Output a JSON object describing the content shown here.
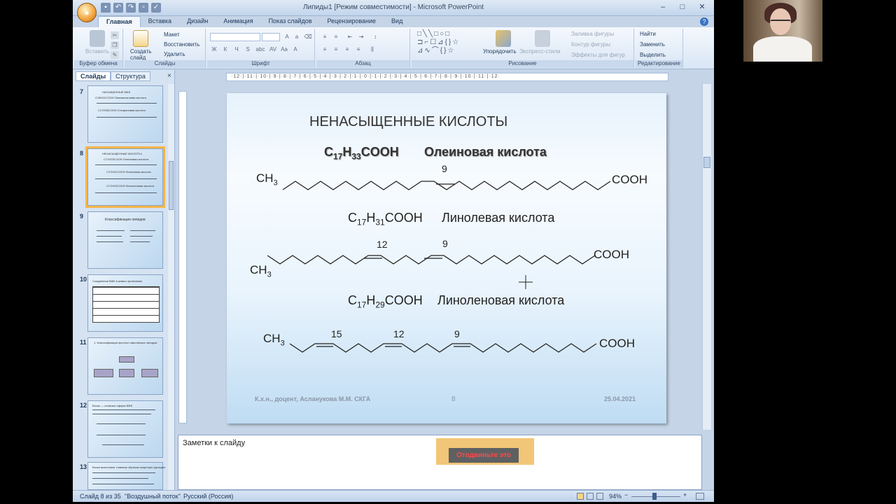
{
  "window": {
    "title": "Липиды1 [Режим совместимости] - Microsoft PowerPoint",
    "office_button_icon": "office-logo-icon",
    "qat_icons": [
      "save-icon",
      "undo-icon",
      "redo-icon",
      "print-preview-icon",
      "spelling-icon"
    ],
    "controls": [
      "–",
      "□",
      "✕"
    ]
  },
  "ribbon": {
    "tabs": [
      "Главная",
      "Вставка",
      "Дизайн",
      "Анимация",
      "Показ слайдов",
      "Рецензирование",
      "Вид"
    ],
    "active_tab": "Главная",
    "clipboard": {
      "paste": "Вставить",
      "label": "Буфер обмена"
    },
    "slides": {
      "create": "Создать слайд",
      "layout": "Макет",
      "reset": "Восстановить",
      "delete": "Удалить",
      "label": "Слайды"
    },
    "font": {
      "label": "Шрифт",
      "buttons": [
        "Ж",
        "К",
        "Ч",
        "S",
        "abc",
        "AV",
        "Aa",
        "A"
      ]
    },
    "paragraph": {
      "label": "Абзац"
    },
    "drawing": {
      "arrange": "Упорядочить",
      "quick_styles": "Экспресс-стили",
      "fill": "Заливка фигуры",
      "outline": "Контур фигуры",
      "effects": "Эффекты для фигур",
      "label": "Рисование"
    },
    "editing": {
      "find": "Найти",
      "replace": "Заменить",
      "select": "Выделить",
      "label": "Редактирование"
    }
  },
  "left_panel": {
    "tabs": [
      "Слайды",
      "Структура"
    ],
    "close": "×",
    "thumbnails": [
      {
        "num": "7",
        "lines": [
          "НАСЫЩЕННЫЕ ВЖК",
          "C15H31COOH   Пальмитиновая кислота",
          "C17H35COOH   Стеариновая кислота"
        ]
      },
      {
        "num": "8",
        "lines": [
          "НЕНАСЫЩЕННЫЕ КИСЛОТЫ",
          "C17H33COOH Олеиновая кислота",
          "C17H31COOH Линолевая кислота",
          "C17H29COOH Линоленовая кислота"
        ]
      },
      {
        "num": "9",
        "lines": [
          "Классификация липидов"
        ]
      },
      {
        "num": "10",
        "lines": [
          "Соединения ВЖК в живых организмах"
        ]
      },
      {
        "num": "11",
        "lines": [
          "1. Классификация простых омыляемых липидов"
        ]
      },
      {
        "num": "12",
        "lines": [
          "Воски — сложные эфиры ВЖК"
        ]
      },
      {
        "num": "13",
        "lines": [
          "Воски выполняют главным образом защитную функцию"
        ]
      }
    ]
  },
  "slide": {
    "title": "НЕНАСЫЩЕННЫЕ   КИСЛОТЫ",
    "acids": [
      {
        "formula_prefix": "C",
        "c_sub": "17",
        "h": "H",
        "h_sub": "33",
        "suffix": "COOH",
        "name": "Олеиновая кислота",
        "double_bonds": [
          "9"
        ]
      },
      {
        "formula_prefix": "C",
        "c_sub": "17",
        "h": "H",
        "h_sub": "31",
        "suffix": "COOH",
        "name": "Линолевая кислота",
        "double_bonds": [
          "12",
          "9"
        ]
      },
      {
        "formula_prefix": "C",
        "c_sub": "17",
        "h": "H",
        "h_sub": "29",
        "suffix": "COOH",
        "name": "Линоленовая кислота",
        "double_bonds": [
          "15",
          "12",
          "9"
        ]
      }
    ],
    "ch3": "CH",
    "ch3_sub": "3",
    "cooh": "COOH",
    "footer_author": "К.х.н., доцент, Асланукова М.М.  СКГА",
    "footer_page": "8",
    "footer_date": "25.04.2021"
  },
  "notes": {
    "label": "Заметки к слайду",
    "overlay_text": "Отодвиньте это"
  },
  "status_bar": {
    "slide_info": "Слайд 8 из 35",
    "theme": "\"Воздушный поток\"",
    "language": "Русский (Россия)",
    "zoom": "94%",
    "zoom_minus": "−",
    "zoom_plus": "+"
  },
  "colors": {
    "ribbon": "#d9e6f5",
    "selected_thumb": "#f5b64a",
    "overlay_bg": "#f2c678"
  }
}
